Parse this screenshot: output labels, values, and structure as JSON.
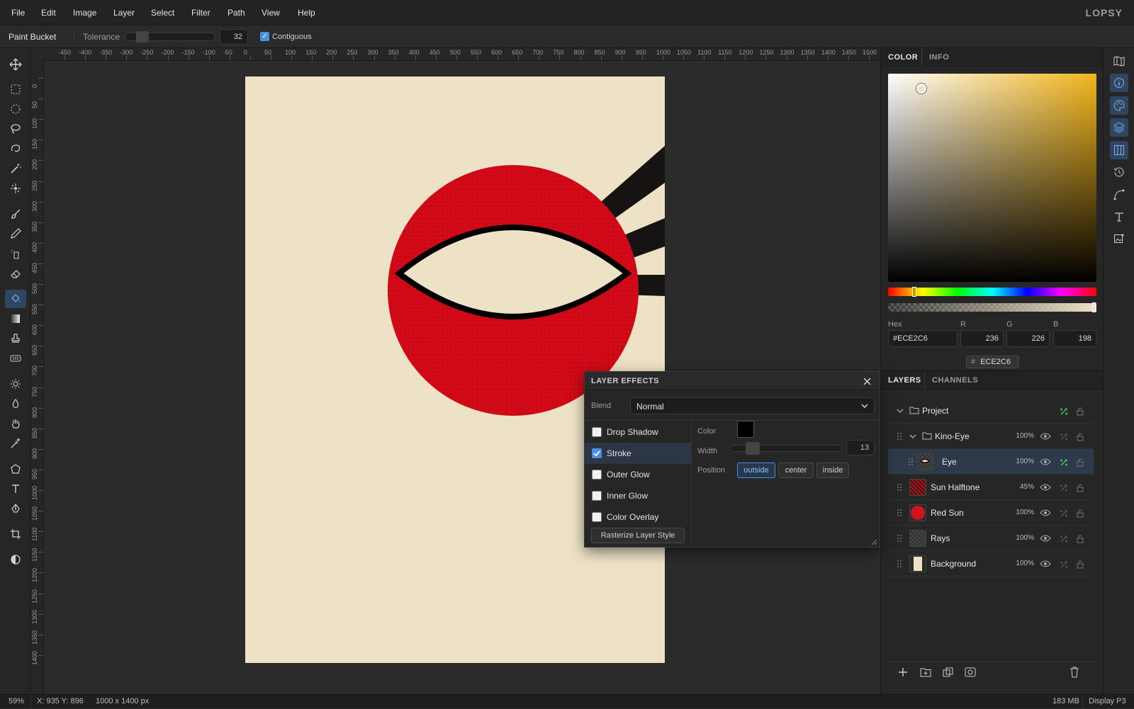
{
  "menu": {
    "items": [
      "File",
      "Edit",
      "Image",
      "Layer",
      "Select",
      "Filter",
      "Path",
      "View",
      "Help"
    ],
    "brand": "LOPSY"
  },
  "options": {
    "tool_name": "Paint Bucket",
    "tolerance_label": "Tolerance",
    "tolerance_value": "32",
    "tolerance_fraction": 0.12,
    "contiguous_label": "Contiguous",
    "contiguous_checked": true
  },
  "tools": [
    "move-icon",
    "rect-select-icon",
    "ellipse-select-icon",
    "lasso-icon",
    "magnetic-lasso-icon",
    "magic-wand-icon",
    "quick-select-icon",
    "brush-icon",
    "pencil-icon",
    "spray-icon",
    "eraser-icon",
    "paint-bucket-icon",
    "gradient-icon",
    "stamp-icon",
    "patch-icon",
    "dodge-icon",
    "blur-icon",
    "hand-icon",
    "eyedropper-icon",
    "polygon-icon",
    "text-icon",
    "pen-icon",
    "crop-icon",
    "contrast-icon"
  ],
  "active_tool": "paint-bucket-icon",
  "rulers": {
    "top": [
      "-450",
      "-400",
      "-350",
      "-300",
      "-250",
      "-200",
      "-150",
      "-100",
      "-50",
      "0",
      "50",
      "100",
      "150",
      "200",
      "250",
      "300",
      "350",
      "400",
      "450",
      "500",
      "550",
      "600",
      "650",
      "700",
      "750",
      "800",
      "850",
      "900",
      "950",
      "1000",
      "1050",
      "1100",
      "1150",
      "1200",
      "1250",
      "1300",
      "1350",
      "1400",
      "1450",
      "1500"
    ],
    "left": [
      "0",
      "50",
      "100",
      "150",
      "200",
      "250",
      "300",
      "350",
      "400",
      "450",
      "500",
      "550",
      "600",
      "650",
      "700",
      "750",
      "800",
      "850",
      "900",
      "950",
      "1000",
      "1050",
      "1100",
      "1150",
      "1200",
      "1250",
      "1300",
      "1350",
      "1400"
    ]
  },
  "color_panel": {
    "tab_color": "COLOR",
    "tab_info": "INFO",
    "hex_label": "Hex",
    "hex_value": "#ECE2C6",
    "r_label": "R",
    "g_label": "G",
    "b_label": "B",
    "r_value": "236",
    "g_value": "226",
    "b_value": "198",
    "swatch_label": "ECE2C6",
    "hue_color": "#f2b61c"
  },
  "layers_panel": {
    "tab_layers": "LAYERS",
    "tab_channels": "CHANNELS",
    "rows": [
      {
        "name": "Project",
        "opacity": ""
      },
      {
        "name": "Kino-Eye",
        "opacity": "100%"
      },
      {
        "name": "Eye",
        "opacity": "100%"
      },
      {
        "name": "Sun Halftone",
        "opacity": "45%"
      },
      {
        "name": "Red Sun",
        "opacity": "100%"
      },
      {
        "name": "Rays",
        "opacity": "100%"
      },
      {
        "name": "Background",
        "opacity": "100%"
      }
    ]
  },
  "layer_effects": {
    "title": "LAYER EFFECTS",
    "blend_label": "Blend",
    "blend_value": "Normal",
    "effects": [
      {
        "label": "Drop Shadow",
        "checked": false
      },
      {
        "label": "Stroke",
        "checked": true
      },
      {
        "label": "Outer Glow",
        "checked": false
      },
      {
        "label": "Inner Glow",
        "checked": false
      },
      {
        "label": "Color Overlay",
        "checked": false
      }
    ],
    "rasterize_label": "Rasterize Layer Style",
    "color_label": "Color",
    "stroke_color": "#000000",
    "width_label": "Width",
    "width_value": "13",
    "width_fraction": 0.13,
    "position_label": "Position",
    "positions": [
      "outside",
      "center",
      "inside"
    ],
    "position_selected": "outside"
  },
  "status": {
    "zoom": "59%",
    "coords": "X: 935 Y: 896",
    "doc_size": "1000 x 1400 px",
    "memory": "183 MB",
    "profile": "Display P3"
  },
  "colors": {
    "accent": "#4a90e2",
    "paper": "#ede2c6",
    "sun": "#d20a18",
    "ink": "#141414"
  }
}
